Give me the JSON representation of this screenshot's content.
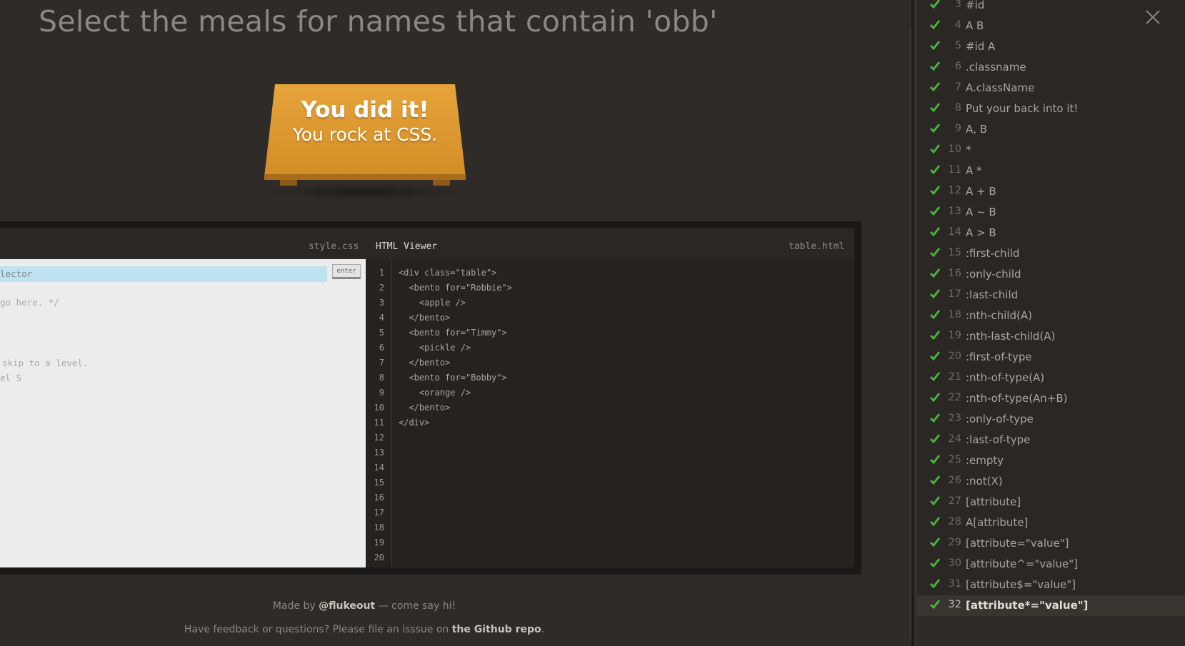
{
  "order_title": "Select the meals for names that contain 'obb'",
  "winner": {
    "line1": "You did it!",
    "line2": "You rock at CSS."
  },
  "editor": {
    "css_tab": "style.css",
    "html_tab": "HTML Viewer",
    "html_file": "table.html",
    "input_value": "lector",
    "enter_label": "enter",
    "css_comments": [
      "go here. */",
      "skip to a level.",
      "el 5"
    ],
    "line_numbers": [
      "1",
      "2",
      "3",
      "4",
      "5",
      "6",
      "7",
      "8",
      "9",
      "10",
      "11",
      "12",
      "13",
      "14",
      "15",
      "16",
      "17",
      "18",
      "19",
      "20"
    ],
    "html_lines": [
      "<div class=\"table\">",
      "  <bento for=\"Robbie\">",
      "    <apple />",
      "  </bento>",
      "  <bento for=\"Timmy\">",
      "    <pickle />",
      "  </bento>",
      "  <bento for=\"Bobby\">",
      "    <orange />",
      "  </bento>",
      "</div>"
    ]
  },
  "footer": {
    "made_by": "Made by",
    "author": "@flukeout",
    "say_hi": "— come say hi!",
    "feedback": "Have feedback or questions? Please file an isssue on",
    "repo": "the Github repo",
    "period": "."
  },
  "colors": {
    "check": "#4caf3f",
    "table": "#e0a030",
    "input_bg": "#bfe2ef"
  },
  "levels": [
    {
      "num": "3",
      "name": "#id",
      "done": true
    },
    {
      "num": "4",
      "name": "A  B",
      "done": true
    },
    {
      "num": "5",
      "name": "#id  A",
      "done": true
    },
    {
      "num": "6",
      "name": ".classname",
      "done": true
    },
    {
      "num": "7",
      "name": "A.className",
      "done": true
    },
    {
      "num": "8",
      "name": "Put your back into it!",
      "done": true
    },
    {
      "num": "9",
      "name": "A, B",
      "done": true
    },
    {
      "num": "10",
      "name": "*",
      "done": true
    },
    {
      "num": "11",
      "name": "A  *",
      "done": true
    },
    {
      "num": "12",
      "name": "A + B",
      "done": true
    },
    {
      "num": "13",
      "name": "A ~ B",
      "done": true
    },
    {
      "num": "14",
      "name": "A > B",
      "done": true
    },
    {
      "num": "15",
      "name": ":first-child",
      "done": true
    },
    {
      "num": "16",
      "name": ":only-child",
      "done": true
    },
    {
      "num": "17",
      "name": ":last-child",
      "done": true
    },
    {
      "num": "18",
      "name": ":nth-child(A)",
      "done": true
    },
    {
      "num": "19",
      "name": ":nth-last-child(A)",
      "done": true
    },
    {
      "num": "20",
      "name": ":first-of-type",
      "done": true
    },
    {
      "num": "21",
      "name": ":nth-of-type(A)",
      "done": true
    },
    {
      "num": "22",
      "name": ":nth-of-type(An+B)",
      "done": true
    },
    {
      "num": "23",
      "name": ":only-of-type",
      "done": true
    },
    {
      "num": "24",
      "name": ":last-of-type",
      "done": true
    },
    {
      "num": "25",
      "name": ":empty",
      "done": true
    },
    {
      "num": "26",
      "name": ":not(X)",
      "done": true
    },
    {
      "num": "27",
      "name": "[attribute]",
      "done": true
    },
    {
      "num": "28",
      "name": "A[attribute]",
      "done": true
    },
    {
      "num": "29",
      "name": "[attribute=\"value\"]",
      "done": true
    },
    {
      "num": "30",
      "name": "[attribute^=\"value\"]",
      "done": true
    },
    {
      "num": "31",
      "name": "[attribute$=\"value\"]",
      "done": true
    },
    {
      "num": "32",
      "name": "[attribute*=\"value\"]",
      "done": true,
      "current": true
    }
  ]
}
